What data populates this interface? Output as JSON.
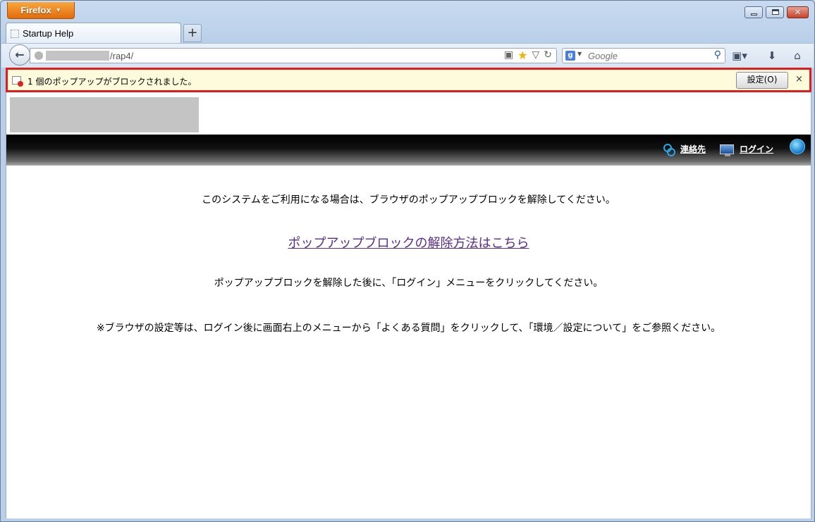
{
  "browser": {
    "app_button": "Firefox",
    "tab_title": "Startup Help",
    "new_tab_label": "+",
    "url_path": "/rap4/",
    "search_placeholder": "Google"
  },
  "notification": {
    "message": "1 個のポップアップがブロックされました。",
    "settings_button": "設定(O)",
    "close_label": "×",
    "highlight_color": "#e31b1b"
  },
  "site": {
    "nav": {
      "contact": "連絡先",
      "login": "ログイン"
    },
    "body": {
      "line1": "このシステムをご利用になる場合は、ブラウザのポップアップブロックを解除してください。",
      "help_link": "ポップアップブロックの解除方法はこちら",
      "line2": "ポップアップブロックを解除した後に、「ログイン」メニューをクリックしてください。",
      "line3": "※ブラウザの設定等は、ログイン後に画面右上のメニューから「よくある質問」をクリックして、「環境／設定について」をご参照ください。"
    }
  },
  "icons": {
    "back": "back-arrow-icon",
    "globe": "site-identity-icon",
    "bookmark": "bookmark-star-icon",
    "reload": "reload-icon",
    "search": "search-icon",
    "bookmarks_menu": "bookmarks-menu-icon",
    "downloads": "download-icon",
    "home": "home-icon"
  }
}
